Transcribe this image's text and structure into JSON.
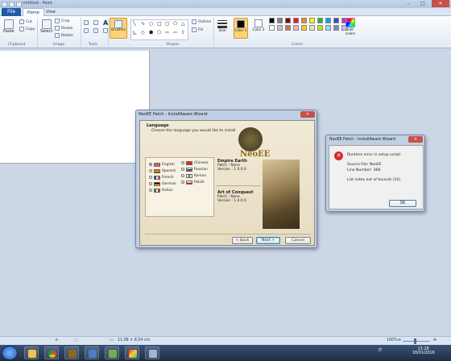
{
  "paint": {
    "title_bar": {
      "document_title": "Untitled - Paint"
    },
    "tabs": {
      "file": "File",
      "home": "Home",
      "view": "View"
    },
    "clipboard": {
      "paste": "Paste",
      "cut": "Cut",
      "copy": "Copy",
      "label": "Clipboard"
    },
    "image": {
      "select": "Select",
      "crop": "Crop",
      "resize": "Resize",
      "rotate": "Rotate",
      "label": "Image"
    },
    "tools": {
      "label": "Tools",
      "text_tool": "A"
    },
    "brushes": {
      "label": "Brushes"
    },
    "shapes": {
      "outline": "Outline",
      "fill": "Fill",
      "label": "Shapes"
    },
    "size": {
      "label": "Size"
    },
    "colors": {
      "color1": "Color 1",
      "color2": "Color 2",
      "edit": "Edit colors",
      "label": "Colors",
      "swatches": [
        "#000000",
        "#7f7f7f",
        "#880015",
        "#ed1c24",
        "#ff7f27",
        "#fff200",
        "#22b14c",
        "#00a2e8",
        "#3f48cc",
        "#a349a4",
        "#ffffff",
        "#c3c3c3",
        "#b97a57",
        "#ffaec9",
        "#ffc90e",
        "#efe4b0",
        "#b5e61d",
        "#99d9ea",
        "#7092be",
        "#c8bfe7"
      ],
      "color1_value": "#000000",
      "color2_value": "#ffffff"
    },
    "status": {
      "dimensions": "11,08 × 8,54 cm",
      "zoom": "100%"
    }
  },
  "wizard": {
    "title": "NeoEE Patch - InstallAware Wizard",
    "heading": "Language",
    "subheading": "Choose the language you would like to install.",
    "logo": "NeoEE",
    "languages": [
      {
        "name": "English",
        "selected": true
      },
      {
        "name": "Spanish",
        "selected": false
      },
      {
        "name": "French",
        "selected": false
      },
      {
        "name": "German",
        "selected": false
      },
      {
        "name": "Italian",
        "selected": false
      },
      {
        "name": "Chinese",
        "selected": false
      },
      {
        "name": "Russian",
        "selected": false
      },
      {
        "name": "Korean",
        "selected": false
      },
      {
        "name": "Polish",
        "selected": false
      }
    ],
    "games": [
      {
        "title": "Empire Earth",
        "patch": "Patch : None",
        "version": "Version : 1.0.0.0"
      },
      {
        "title": "Art of Conquest",
        "patch": "Patch : None",
        "version": "Version : 1.0.0.0"
      }
    ],
    "buttons": {
      "back": "< Back",
      "next": "Next >",
      "cancel": "Cancel"
    }
  },
  "error_dialog": {
    "title": "NeoEE Patch - InstallAware Wizard",
    "line1": "Runtime error in setup script:",
    "line2": "Source File: NeoEE",
    "line3": "Line Number: 368",
    "line4": "List index out of bounds (10)",
    "ok": "OK"
  },
  "taskbar": {
    "lang": "IT",
    "time": "21:28",
    "date": "18/01/2016"
  }
}
